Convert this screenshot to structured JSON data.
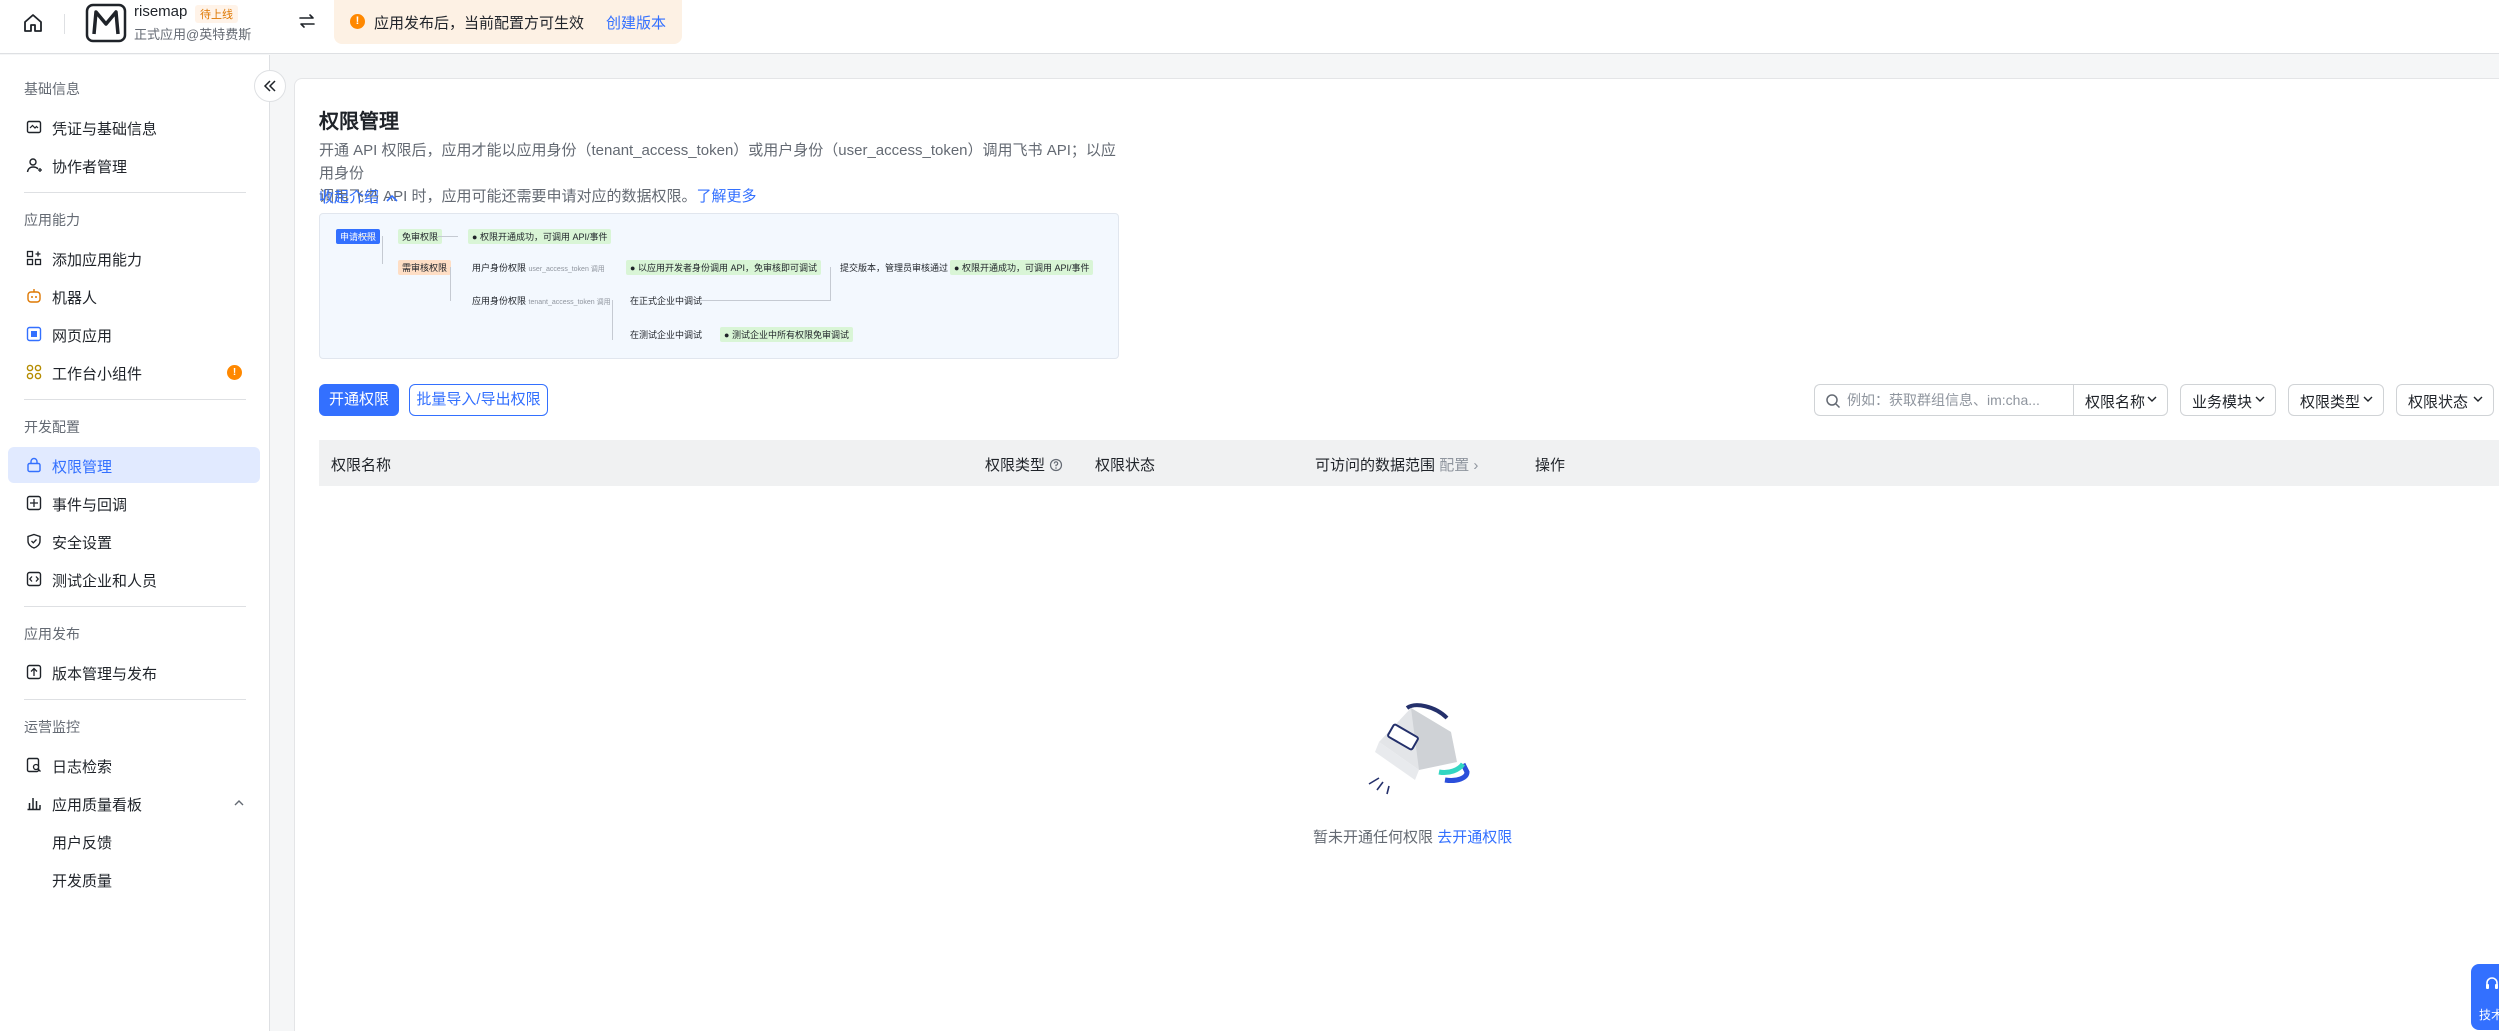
{
  "topbar": {
    "app_name": "risemap",
    "app_badge": "待上线",
    "app_subtitle": "正式应用@英特费斯",
    "notice_text": "应用发布后，当前配置方可生效",
    "notice_link": "创建版本"
  },
  "sidebar": {
    "groups": {
      "basic": "基础信息",
      "ability": "应用能力",
      "dev": "开发配置",
      "release": "应用发布",
      "ops": "运营监控"
    },
    "items": {
      "credentials": "凭证与基础信息",
      "collaborators": "协作者管理",
      "add_ability": "添加应用能力",
      "bot": "机器人",
      "web_app": "网页应用",
      "widget": "工作台小组件",
      "widget_badge": "!",
      "permissions": "权限管理",
      "events": "事件与回调",
      "security": "安全设置",
      "test_company": "测试企业和人员",
      "version": "版本管理与发布",
      "logs": "日志检索",
      "quality": "应用质量看板",
      "feedback": "用户反馈",
      "dev_quality": "开发质量"
    }
  },
  "main": {
    "title": "权限管理",
    "desc_1": "开通 API 权限后，应用才能以应用身份（tenant_access_token）或用户身份（user_access_token）调用飞书 API；以应用身份",
    "desc_2": "调用飞书 API 时，应用可能还需要申请对应的数据权限。",
    "desc_link": "了解更多",
    "fold_link": "收起介绍",
    "flow": {
      "apply": "申请权限",
      "free": "免审权限",
      "free_result": "权限开通成功，可调用 API/事件",
      "review": "需审核权限",
      "user_perm": "用户身份权限",
      "user_token": "user_access_token 调用",
      "dev_identity": "以应用开发者身份调用 API，免审核即可调试",
      "submit": "提交版本，管理员审核通过",
      "success": "权限开通成功，可调用 API/事件",
      "app_perm": "应用身份权限",
      "tenant_token": "tenant_access_token 调用",
      "prod_debug": "在正式企业中调试",
      "test_debug": "在测试企业中调试",
      "test_result": "测试企业中所有权限免审调试"
    },
    "btn_enable": "开通权限",
    "btn_batch": "批量导入/导出权限",
    "search_placeholder": "例如：获取群组信息、im:cha...",
    "filters": [
      "权限名称",
      "业务模块",
      "权限类型",
      "权限状态"
    ],
    "table_headers": {
      "name": "权限名称",
      "type": "权限类型",
      "status": "权限状态",
      "scope": "可访问的数据范围",
      "scope_config": "配置",
      "ops": "操作"
    },
    "empty_text": "暂未开通任何权限",
    "empty_link": "去开通权限"
  },
  "help": {
    "label": "技术"
  },
  "colors": {
    "accent": "#3370ff",
    "warning": "#ff8800",
    "active_bg": "#e1eaff"
  }
}
